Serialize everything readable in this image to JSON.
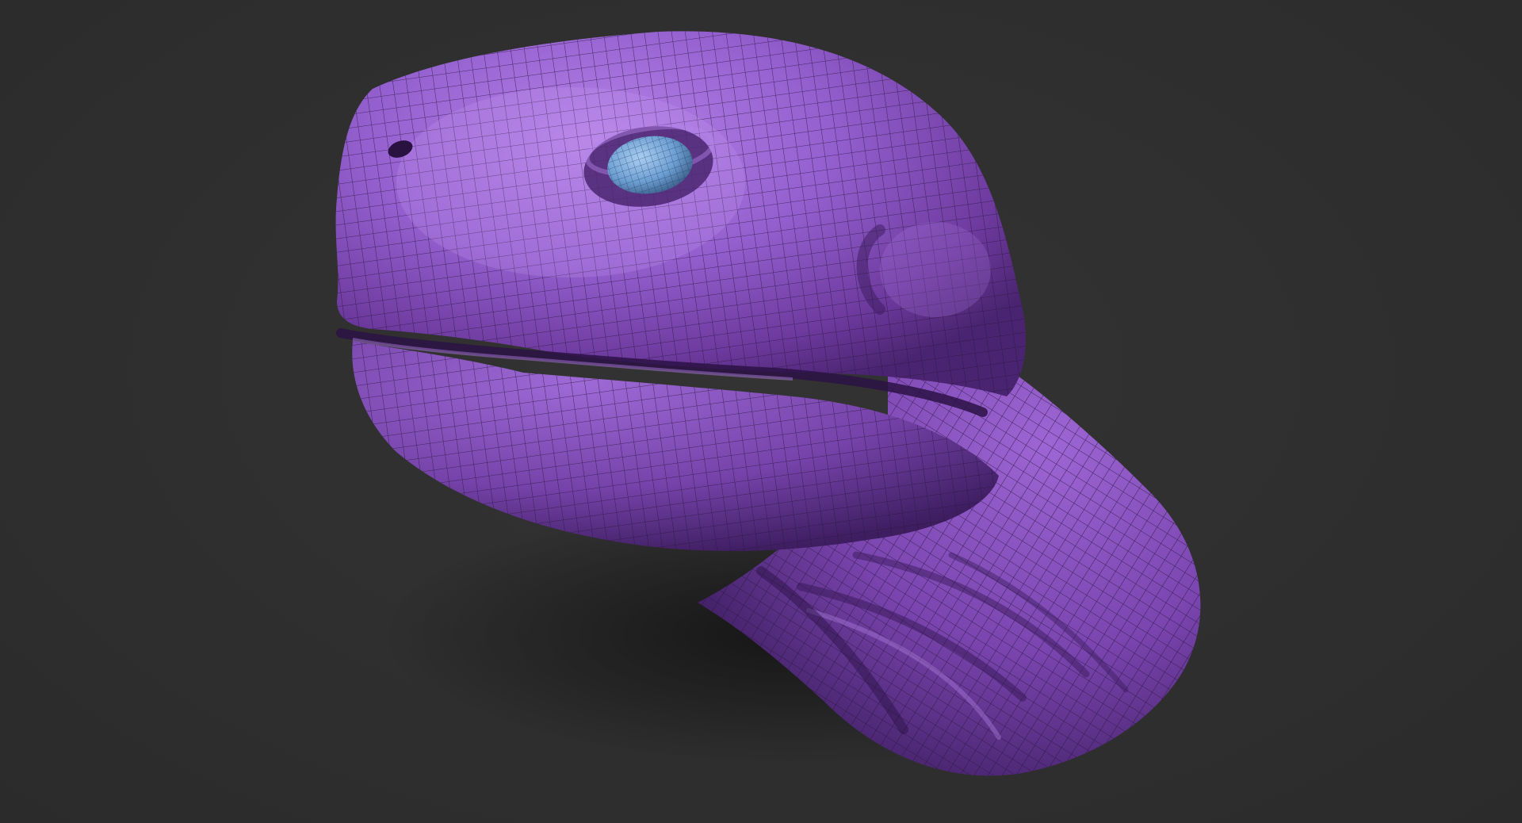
{
  "viewport": {
    "background_color": "#2f2f2f",
    "subject": "creature-head-sculpt",
    "material": {
      "skin_color": "#8e58c8",
      "skin_highlight": "#b27fe6",
      "skin_shadow": "#4b2570",
      "wireframe_color": "#2a1640",
      "eye_color": "#6fa3d6"
    },
    "wireframe_visible": true
  }
}
